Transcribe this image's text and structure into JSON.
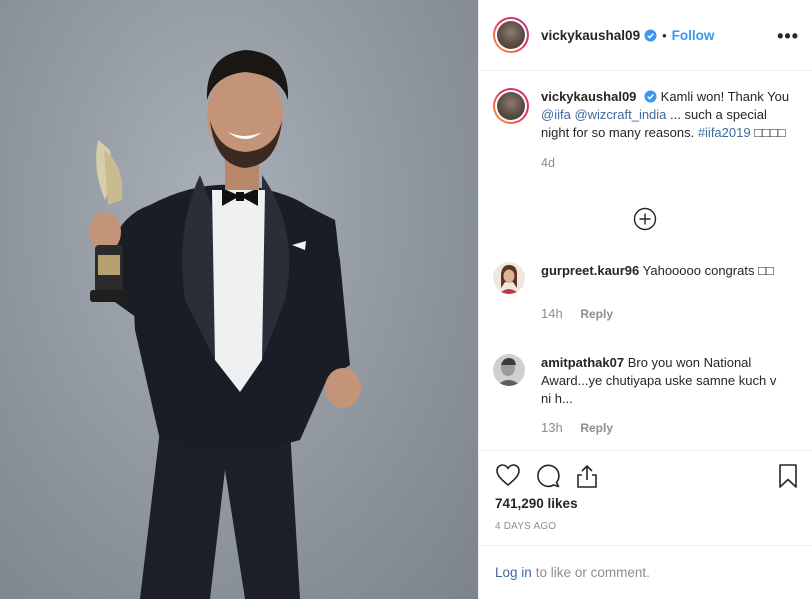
{
  "header": {
    "username": "vickykaushal09",
    "separator": "•",
    "follow_label": "Follow",
    "more_label": "•••"
  },
  "caption": {
    "username": "vickykaushal09",
    "text_part1": "Kamli won! Thank You ",
    "mention1": "@iifa",
    "mention2": "@wizcraft_india",
    "text_part2": " ... such a special night for so many reasons. ",
    "hashtag": "#iifa2019",
    "emojis": "□□□□",
    "timestamp": "4d"
  },
  "comments": [
    {
      "username": "gurpreet.kaur96",
      "text": "Yahooooo congrats □□",
      "time": "14h",
      "reply_label": "Reply"
    },
    {
      "username": "amitpathak07",
      "text": "Bro you won National Award...ye chutiyapa uske samne kuch v ni h...",
      "time": "13h",
      "reply_label": "Reply"
    }
  ],
  "actions": {
    "icons": [
      "heart-icon",
      "comment-icon",
      "share-icon",
      "bookmark-icon"
    ],
    "likes": "741,290 likes",
    "posted_ago": "4 DAYS AGO"
  },
  "login_bar": {
    "login_label": "Log in",
    "suffix": "to like or comment."
  },
  "colors": {
    "link": "#3f6a9e",
    "follow": "#3897f0",
    "verified": "#3897f0",
    "muted": "#8e8e8e"
  }
}
